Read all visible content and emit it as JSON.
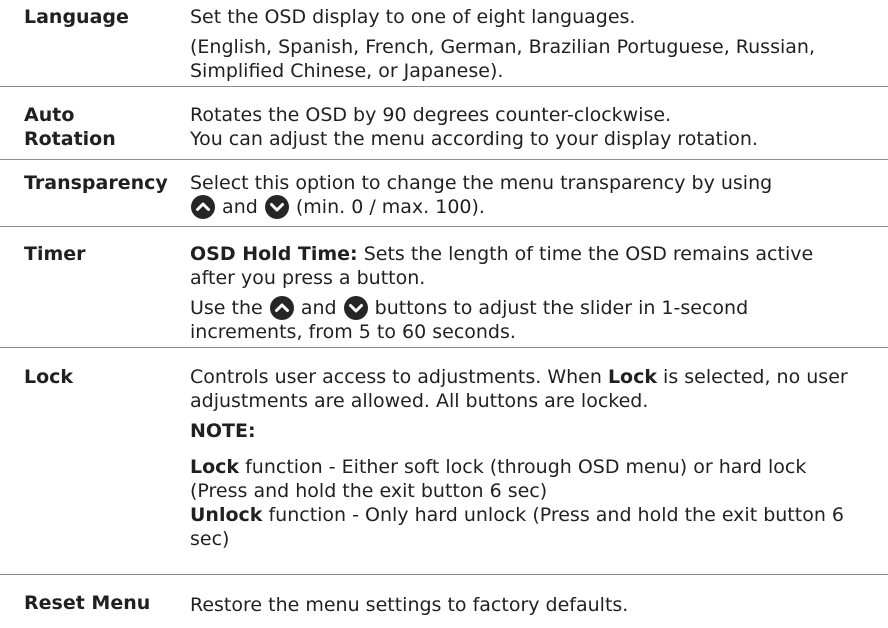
{
  "rows": [
    {
      "label": "Language",
      "lines": [
        "Set the OSD display to one of eight languages.",
        "(English, Spanish, French, German, Brazilian Portuguese, Russian, Simplified Chinese, or Japanese)."
      ]
    },
    {
      "label": "Auto Rotation",
      "lines": [
        "Rotates the OSD by 90 degrees counter-clockwise.",
        "You can adjust the menu according to your display rotation."
      ]
    },
    {
      "label": "Transparency",
      "text_before": "Select this option to change the menu transparency by using",
      "and": "and",
      "text_after": "(min. 0 / max. 100)."
    },
    {
      "label": "Timer",
      "hold_label": "OSD Hold Time:",
      "hold_text": "Sets the length of time the OSD remains active after you press a button.",
      "use_prefix": "Use the",
      "and": "and",
      "use_suffix": "buttons to adjust the slider in 1-second increments, from 5 to 60 seconds."
    },
    {
      "label": "Lock",
      "line1_a": "Controls user access to adjustments. When",
      "line1_bold": "Lock",
      "line1_b": "is selected, no user adjustments are allowed. All buttons are locked.",
      "note": "NOTE:",
      "lock_bold": "Lock",
      "lock_text": "function - Either soft lock (through OSD menu) or hard lock (Press and hold the exit button 6 sec)",
      "unlock_bold": "Unlock",
      "unlock_text": "function - Only hard unlock (Press and hold the exit button 6 sec)"
    },
    {
      "label": "Reset Menu",
      "lines": [
        "Restore the menu settings to factory defaults."
      ]
    }
  ],
  "icons": {
    "up": "chevron-up-icon",
    "down": "chevron-down-icon"
  }
}
